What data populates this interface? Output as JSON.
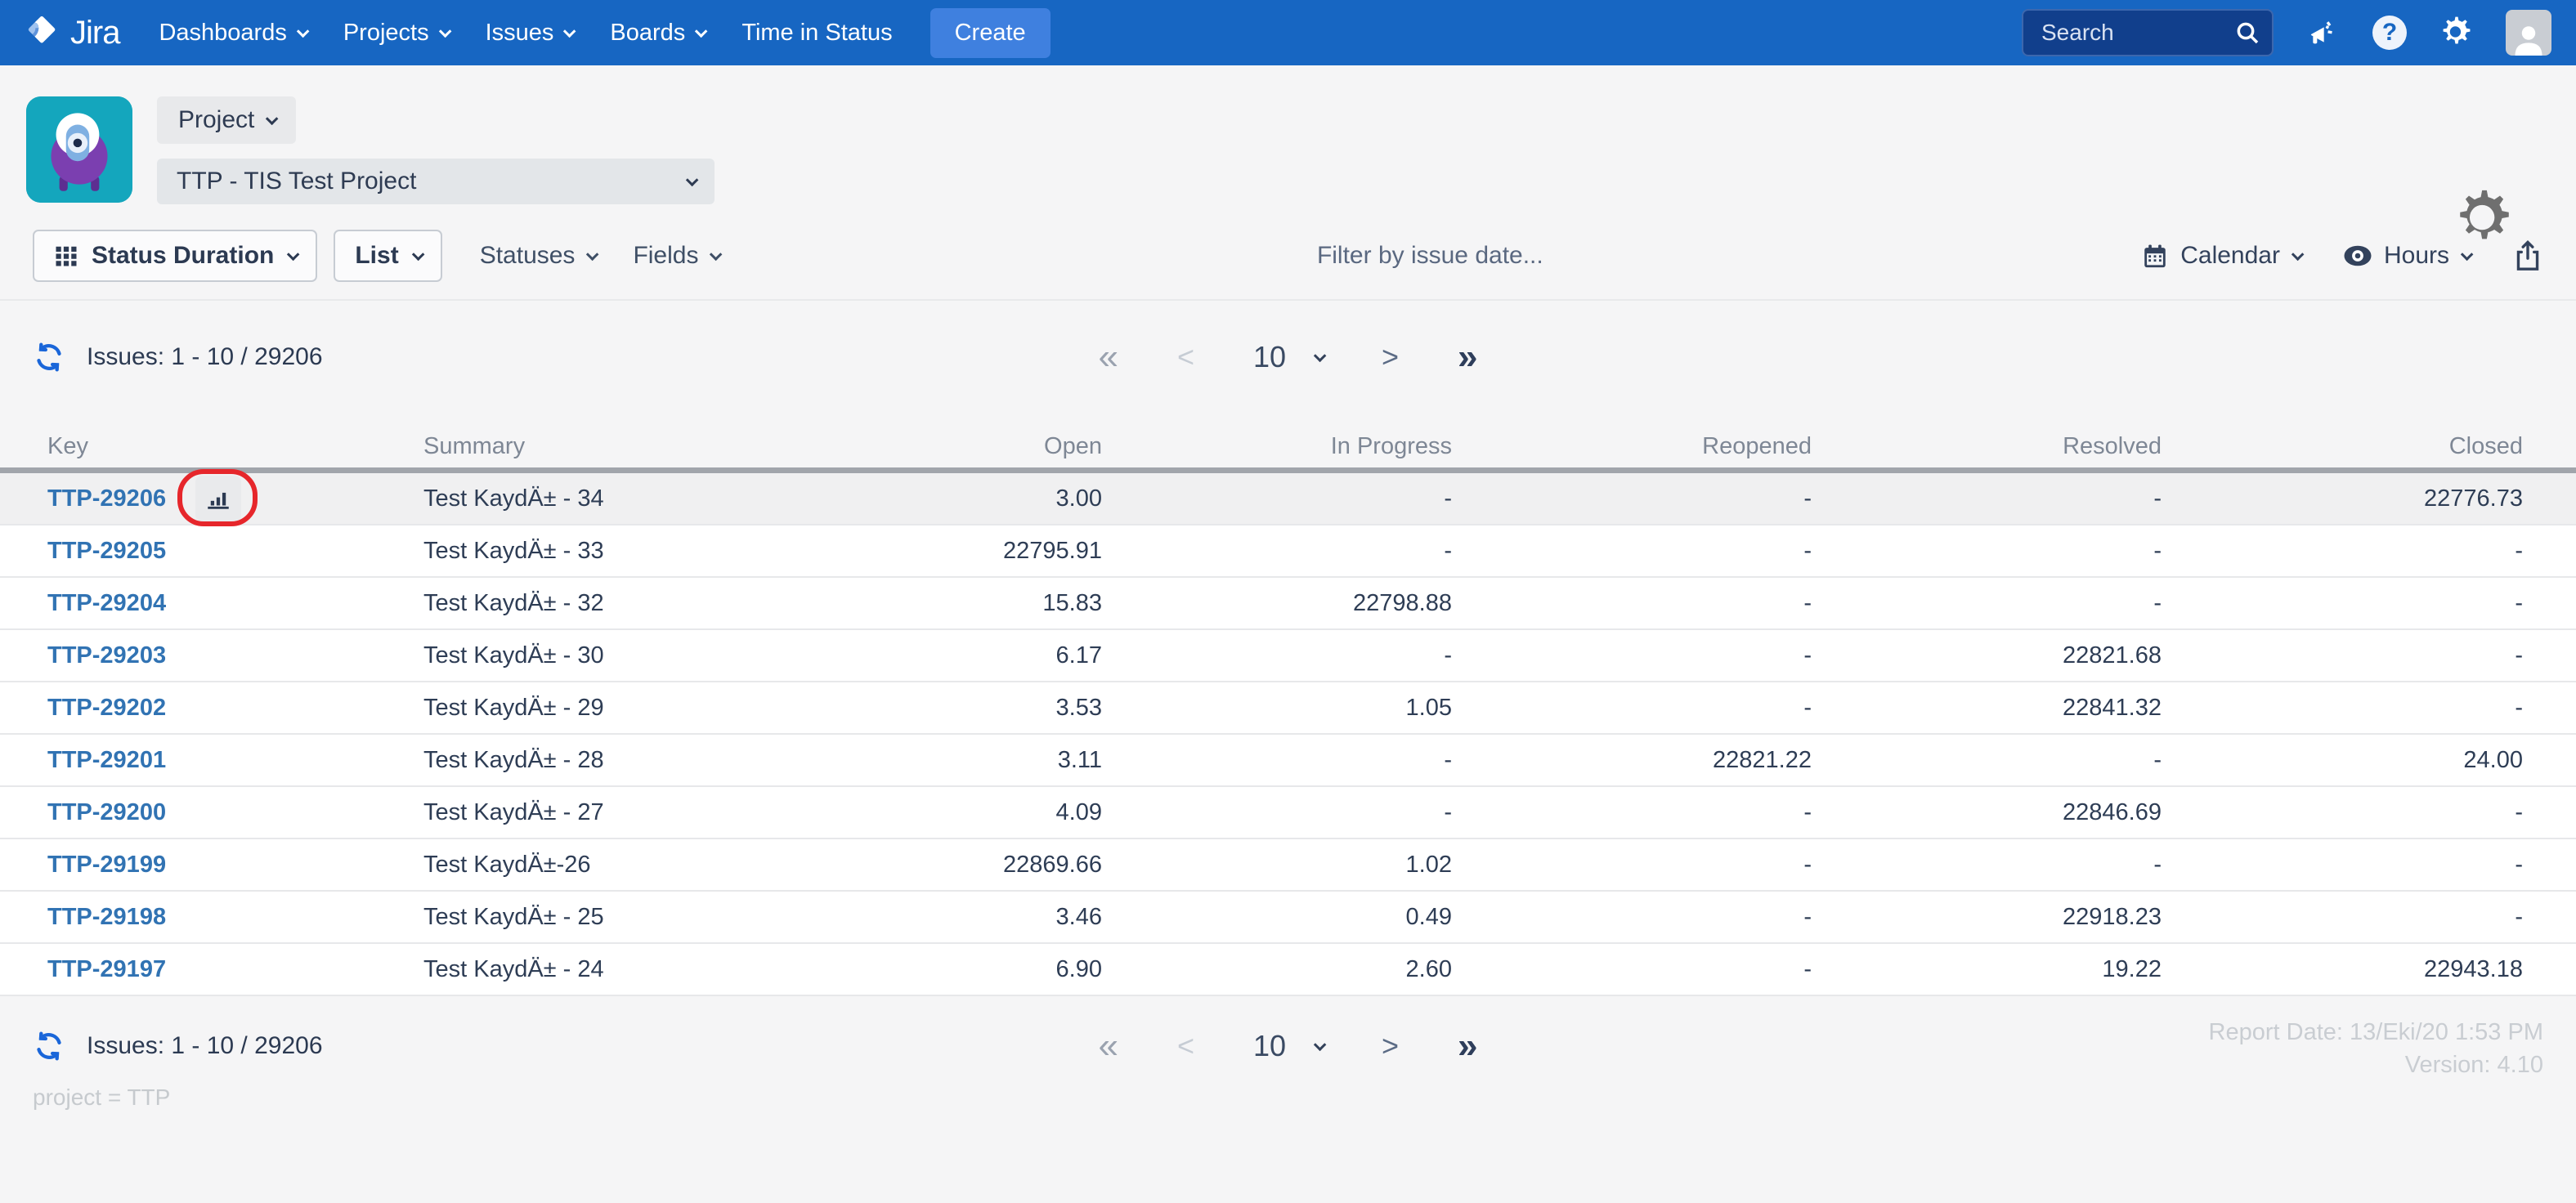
{
  "navbar": {
    "logo_label": "Jira",
    "items": [
      {
        "label": "Dashboards"
      },
      {
        "label": "Projects"
      },
      {
        "label": "Issues"
      },
      {
        "label": "Boards"
      },
      {
        "label": "Time in Status"
      }
    ],
    "create_label": "Create",
    "search_placeholder": "Search"
  },
  "project_header": {
    "scope_button_label": "Project",
    "project_select_value": "TTP - TIS Test Project"
  },
  "toolbar": {
    "report_button_label": "Status Duration",
    "view_button_label": "List",
    "statuses_label": "Statuses",
    "fields_label": "Fields",
    "filter_placeholder": "Filter by issue date...",
    "calendar_label": "Calendar",
    "hours_label": "Hours"
  },
  "pagination": {
    "issues_summary": "Issues: 1 - 10 / 29206",
    "first": "«",
    "prev": "<",
    "page_size": "10",
    "next": ">",
    "last": "»"
  },
  "table": {
    "columns": [
      "Key",
      "Summary",
      "Open",
      "In Progress",
      "Reopened",
      "Resolved",
      "Closed"
    ],
    "rows": [
      {
        "key": "TTP-29206",
        "summary": "Test KaydÄ± - 34",
        "open": "3.00",
        "in_progress": "-",
        "reopened": "-",
        "resolved": "-",
        "closed": "22776.73",
        "highlighted": true,
        "has_chart_icon": true
      },
      {
        "key": "TTP-29205",
        "summary": "Test KaydÄ± - 33",
        "open": "22795.91",
        "in_progress": "-",
        "reopened": "-",
        "resolved": "-",
        "closed": "-",
        "highlighted": false,
        "has_chart_icon": false
      },
      {
        "key": "TTP-29204",
        "summary": "Test KaydÄ± - 32",
        "open": "15.83",
        "in_progress": "22798.88",
        "reopened": "-",
        "resolved": "-",
        "closed": "-",
        "highlighted": false,
        "has_chart_icon": false
      },
      {
        "key": "TTP-29203",
        "summary": "Test KaydÄ± - 30",
        "open": "6.17",
        "in_progress": "-",
        "reopened": "-",
        "resolved": "22821.68",
        "closed": "-",
        "highlighted": false,
        "has_chart_icon": false
      },
      {
        "key": "TTP-29202",
        "summary": "Test KaydÄ± - 29",
        "open": "3.53",
        "in_progress": "1.05",
        "reopened": "-",
        "resolved": "22841.32",
        "closed": "-",
        "highlighted": false,
        "has_chart_icon": false
      },
      {
        "key": "TTP-29201",
        "summary": "Test KaydÄ± - 28",
        "open": "3.11",
        "in_progress": "-",
        "reopened": "22821.22",
        "resolved": "-",
        "closed": "24.00",
        "highlighted": false,
        "has_chart_icon": false
      },
      {
        "key": "TTP-29200",
        "summary": "Test KaydÄ± - 27",
        "open": "4.09",
        "in_progress": "-",
        "reopened": "-",
        "resolved": "22846.69",
        "closed": "-",
        "highlighted": false,
        "has_chart_icon": false
      },
      {
        "key": "TTP-29199",
        "summary": "Test KaydÄ±-26",
        "open": "22869.66",
        "in_progress": "1.02",
        "reopened": "-",
        "resolved": "-",
        "closed": "-",
        "highlighted": false,
        "has_chart_icon": false
      },
      {
        "key": "TTP-29198",
        "summary": "Test KaydÄ± - 25",
        "open": "3.46",
        "in_progress": "0.49",
        "reopened": "-",
        "resolved": "22918.23",
        "closed": "-",
        "highlighted": false,
        "has_chart_icon": false
      },
      {
        "key": "TTP-29197",
        "summary": "Test KaydÄ± - 24",
        "open": "6.90",
        "in_progress": "2.60",
        "reopened": "-",
        "resolved": "19.22",
        "closed": "22943.18",
        "highlighted": false,
        "has_chart_icon": false
      }
    ]
  },
  "footer": {
    "issues_summary": "Issues: 1 - 10 / 29206",
    "report_date": "Report Date: 13/Eki/20 1:53 PM",
    "version": "Version: 4.10",
    "jql_query": "project = TTP"
  },
  "colors": {
    "navbar_blue": "#1766c2",
    "create_button_blue": "#3f80df",
    "link_blue": "#3173b3",
    "annotation_red": "#e6262b",
    "app_avatar_teal": "#14a6bd"
  }
}
